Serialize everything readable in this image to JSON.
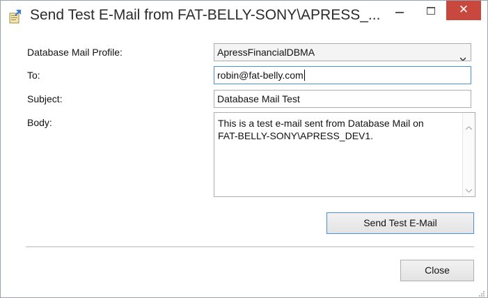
{
  "window": {
    "title": "Send Test E-Mail from FAT-BELLY-SONY\\APRESS_...",
    "icon": "mail-send-icon",
    "close_glyph": "✕",
    "close_color": "#c9483d"
  },
  "form": {
    "profile_label": "Database Mail Profile:",
    "profile_value": "ApressFinancialDBMA",
    "to_label": "To:",
    "to_value": "robin@fat-belly.com",
    "subject_label": "Subject:",
    "subject_value": "Database Mail Test",
    "body_label": "Body:",
    "body_value": "This is a test e-mail sent from Database Mail on\nFAT-BELLY-SONY\\APRESS_DEV1."
  },
  "buttons": {
    "send_label": "Send Test E-Mail",
    "close_label": "Close"
  }
}
